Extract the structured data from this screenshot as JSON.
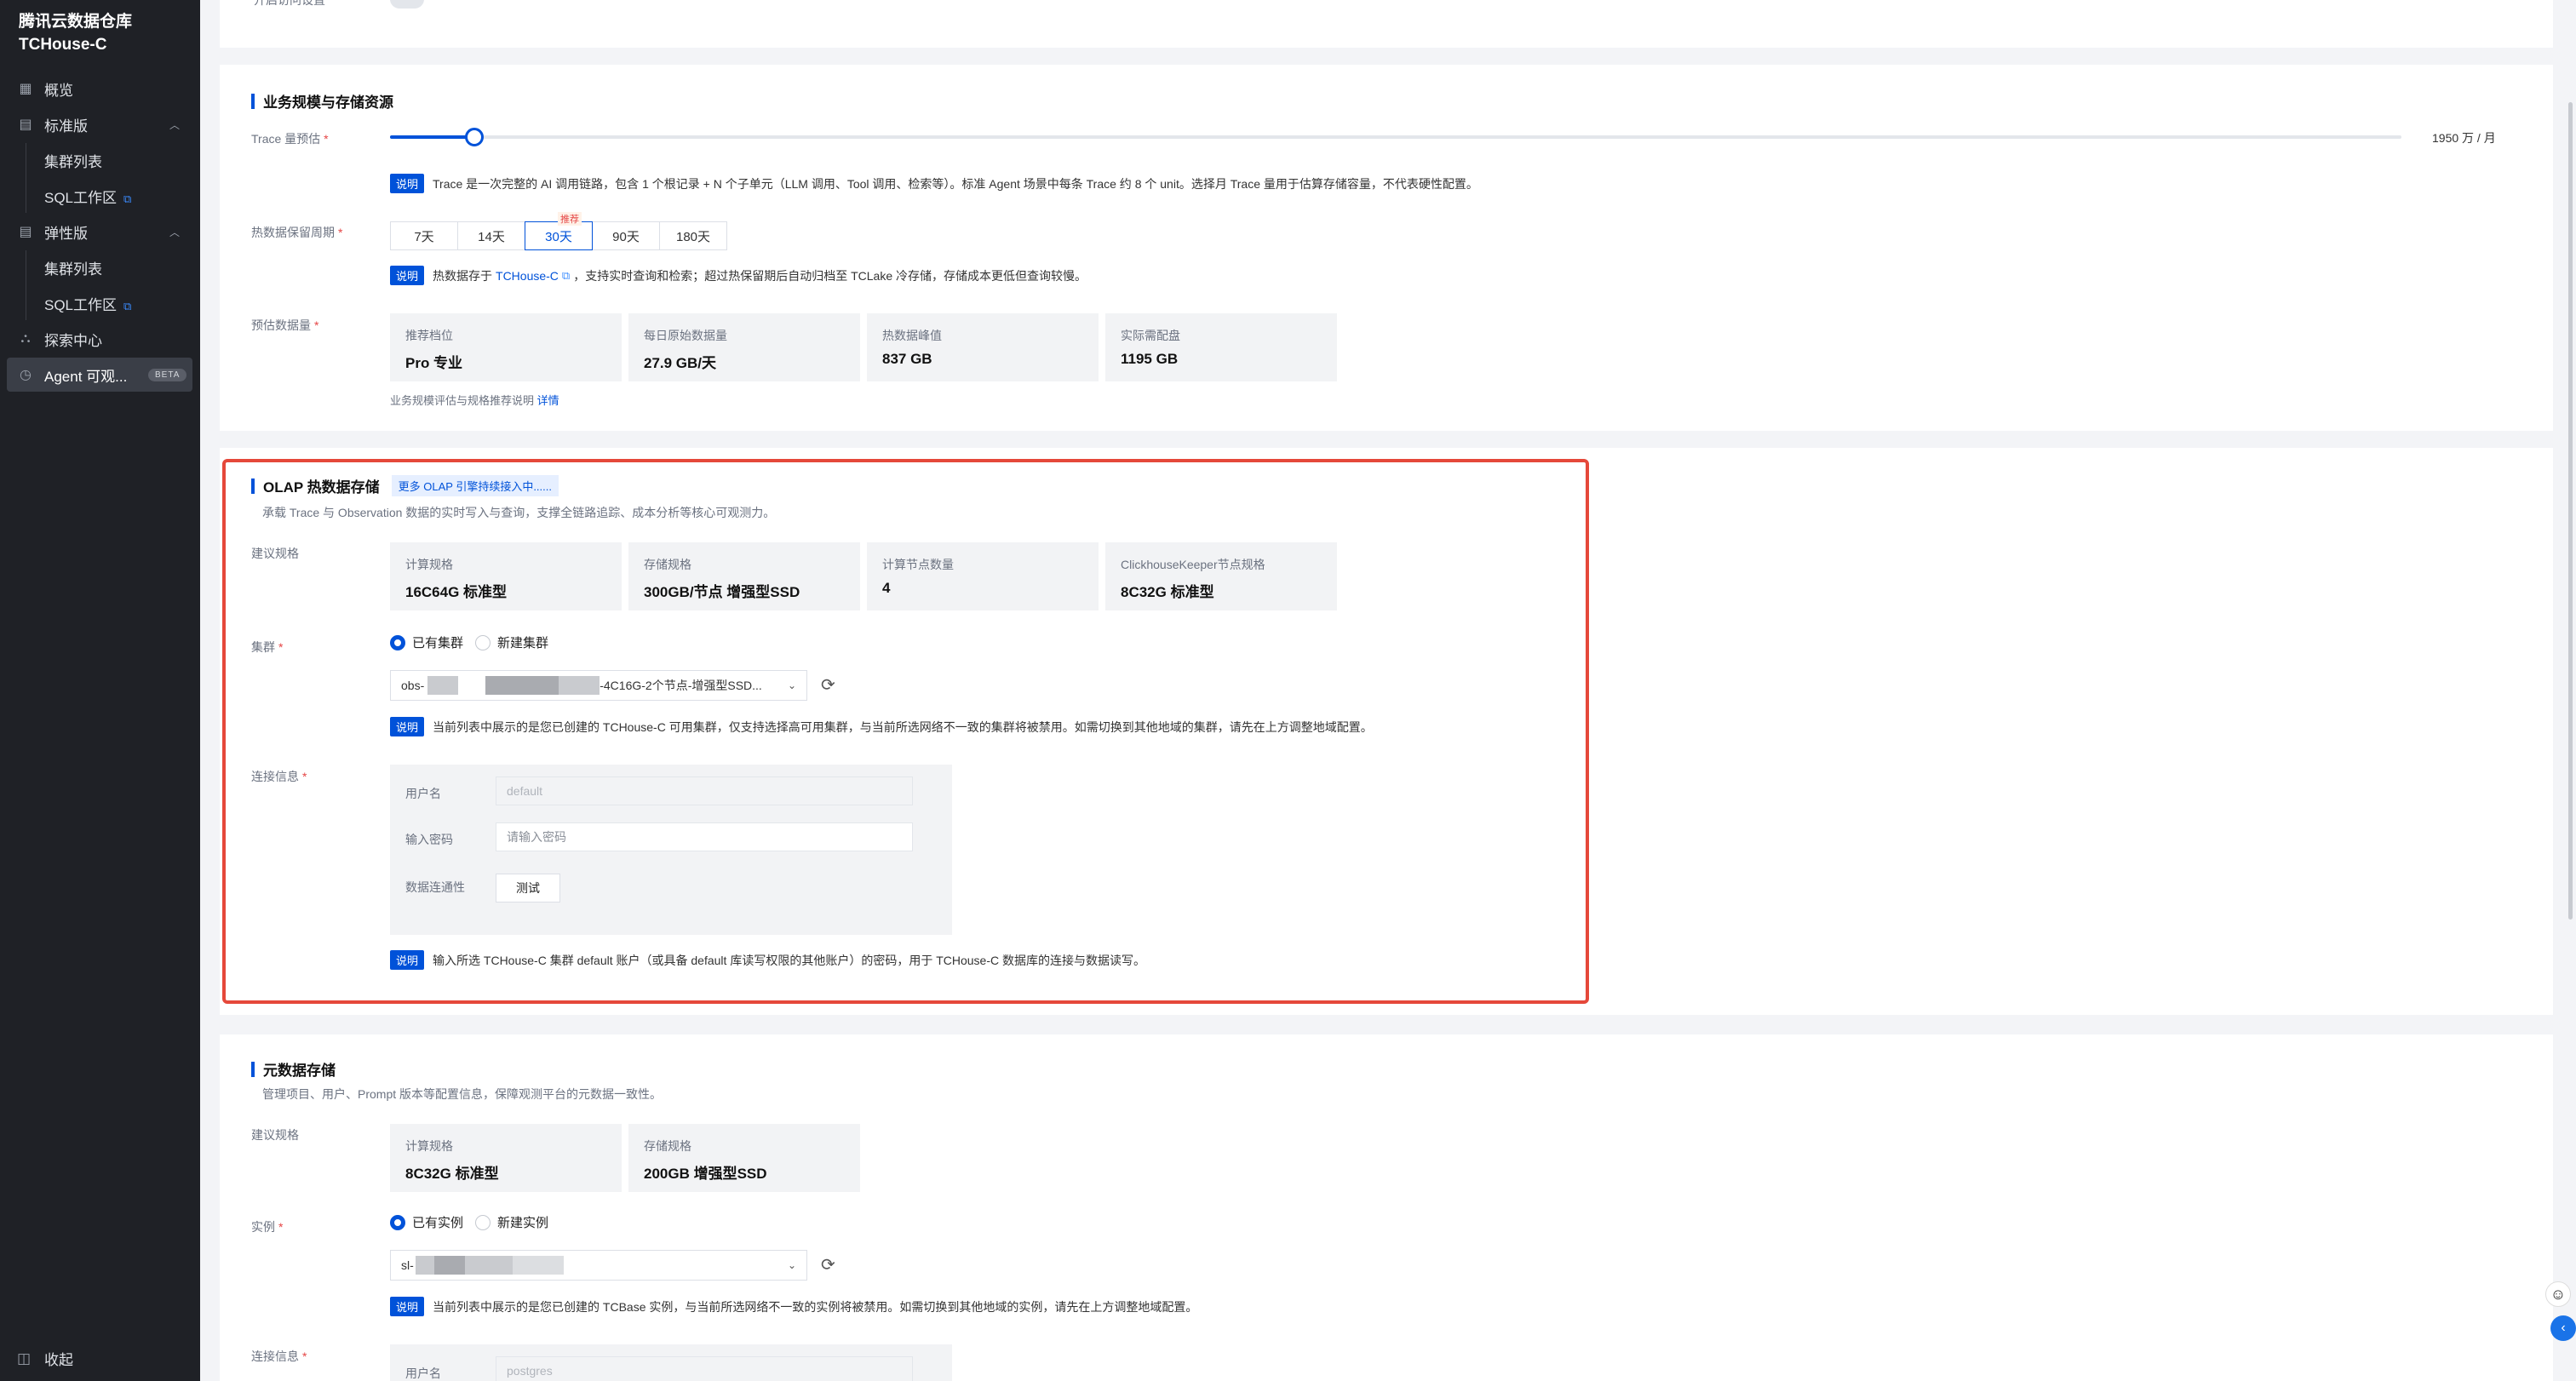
{
  "sidebar": {
    "brand_line1": "腾讯云数据仓库",
    "brand_line2": "TCHouse-C",
    "items": [
      {
        "label": "概览",
        "icon": "grid-icon"
      },
      {
        "label": "标准版",
        "icon": "database-icon"
      },
      {
        "label": "集群列表"
      },
      {
        "label": "SQL工作区"
      },
      {
        "label": "弹性版",
        "icon": "database-icon"
      },
      {
        "label": "集群列表"
      },
      {
        "label": "SQL工作区"
      },
      {
        "label": "探索中心",
        "icon": "explore-icon"
      },
      {
        "label": "Agent 可观...",
        "icon": "agent-icon",
        "badge": "BETA"
      }
    ],
    "collapse_label": "收起"
  },
  "business": {
    "title": "业务规模与存储资源",
    "trace_label": "Trace 量预估",
    "trace_value": "1950 万 / 月",
    "trace_slider_fraction": 0.042,
    "note_tag": "说明",
    "trace_note": "Trace 是一次完整的 AI 调用链路，包含 1 个根记录 + N 个子单元（LLM 调用、Tool 调用、检索等）。标准 Agent 场景中每条 Trace 约 8 个 unit。选择月 Trace 量用于估算存储容量，不代表硬性配置。",
    "retention_label": "热数据保留周期",
    "retention_options": [
      "7天",
      "14天",
      "30天",
      "90天",
      "180天"
    ],
    "retention_selected": "30天",
    "retention_badge": "推荐",
    "retention_note_pre": "热数据存于",
    "retention_note_link": "TCHouse-C",
    "retention_note_post": "，支持实时查询和检索；超过热保留期后自动归档至 TCLake 冷存储，存储成本更低但查询较慢。",
    "estimate_label": "预估数据量",
    "stats": [
      {
        "k": "推荐档位",
        "v": "Pro 专业"
      },
      {
        "k": "每日原始数据量",
        "v": "27.9 GB/天"
      },
      {
        "k": "热数据峰值",
        "v": "837 GB"
      },
      {
        "k": "实际需配盘",
        "v": "1195 GB"
      }
    ],
    "estimate_hint": "业务规模评估与规格推荐说明",
    "estimate_link": "详情"
  },
  "olap": {
    "title": "OLAP 热数据存储",
    "tag": "更多 OLAP 引擎持续接入中......",
    "desc": "承载 Trace 与 Observation 数据的实时写入与查询，支撑全链路追踪、成本分析等核心可观测力。",
    "spec_label": "建议规格",
    "specs": [
      {
        "k": "计算规格",
        "v": "16C64G 标准型"
      },
      {
        "k": "存储规格",
        "v": "300GB/节点 增强型SSD"
      },
      {
        "k": "计算节点数量",
        "v": "4"
      },
      {
        "k": "ClickhouseKeeper节点规格",
        "v": "8C32G 标准型"
      }
    ],
    "cluster_label": "集群",
    "radio_existing": "已有集群",
    "radio_new": "新建集群",
    "select_prefix": "obs-",
    "select_suffix": "-4C16G-2个节点-增强型SSD...",
    "cluster_note": "当前列表中展示的是您已创建的 TCHouse-C 可用集群，仅支持选择高可用集群，与当前所选网络不一致的集群将被禁用。如需切换到其他地域的集群，请先在上方调整地域配置。",
    "conn_label": "连接信息",
    "user_label": "用户名",
    "user_value": "default",
    "pwd_label": "输入密码",
    "pwd_placeholder": "请输入密码",
    "test_label": "数据连通性",
    "test_button": "测试",
    "conn_note": "输入所选 TCHouse-C 集群 default 账户（或具备 default 库读写权限的其他账户）的密码，用于 TCHouse-C 数据库的连接与数据读写。"
  },
  "meta": {
    "title": "元数据存储",
    "desc": "管理项目、用户、Prompt 版本等配置信息，保障观测平台的元数据一致性。",
    "spec_label": "建议规格",
    "specs": [
      {
        "k": "计算规格",
        "v": "8C32G 标准型"
      },
      {
        "k": "存储规格",
        "v": "200GB 增强型SSD"
      }
    ],
    "instance_label": "实例",
    "radio_existing": "已有实例",
    "radio_new": "新建实例",
    "select_prefix": "sl-",
    "instance_note": "当前列表中展示的是您已创建的 TCBase 实例，与当前所选网络不一致的实例将被禁用。如需切换到其他地域的实例，请先在上方调整地域配置。",
    "conn_label": "连接信息",
    "user_label": "用户名",
    "user_value": "postgres"
  },
  "top_partial": {
    "label": "开启访问设置"
  },
  "colors": {
    "accent": "#0052d9",
    "highlight": "#e5483a",
    "sidebar_bg": "#1f2126"
  }
}
